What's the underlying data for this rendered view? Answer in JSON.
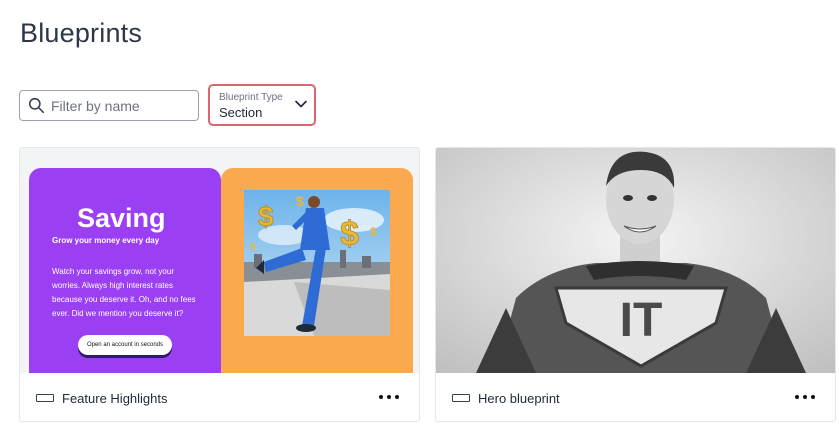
{
  "page": {
    "title": "Blueprints"
  },
  "filters": {
    "search_placeholder": "Filter by name",
    "type_label": "Blueprint Type",
    "type_value": "Section"
  },
  "cards": [
    {
      "name": "Feature Highlights",
      "thumbnail": {
        "heading": "Saving",
        "subheading": "Grow your money every day",
        "body": "Watch your savings grow, not your worries. Always high interest rates because you deserve it. Oh, and no fees ever. Did we mention you deserve it?",
        "cta": "Open an account in seconds"
      }
    },
    {
      "name": "Hero blueprint",
      "thumbnail": {
        "emblem_text": "IT"
      }
    }
  ],
  "colors": {
    "select_border": "#e06470",
    "saving_purple": "#9b3ff2",
    "saving_orange": "#fba94e"
  }
}
